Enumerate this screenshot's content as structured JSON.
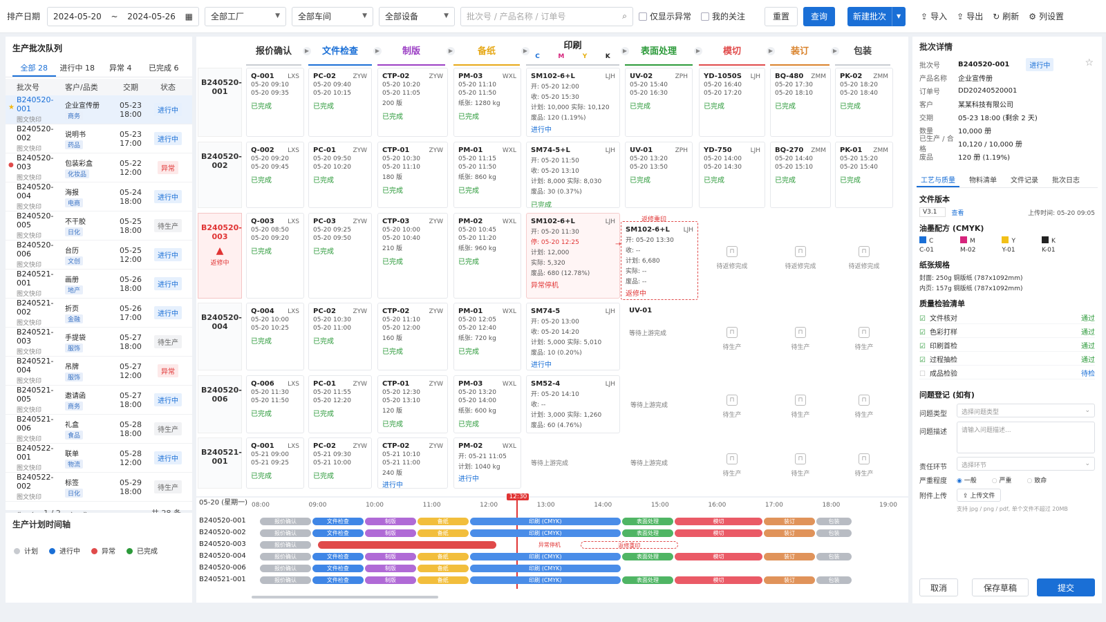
{
  "toolbar": {
    "date_label": "排产日期",
    "date_from": "2024-05-20",
    "date_sep": "~",
    "date_to": "2024-05-26",
    "factory": "全部工厂",
    "workshop": "全部车间",
    "device": "全部设备",
    "search_placeholder": "批次号 / 产品名称 / 订单号",
    "only_abnormal": "仅显示异常",
    "my_follow": "我的关注",
    "reset": "重置",
    "query": "查询",
    "new_batch": "新建批次",
    "import": "导入",
    "export": "导出",
    "refresh": "刷新",
    "column_settings": "列设置"
  },
  "queue": {
    "title": "生产批次队列",
    "tabs": [
      "全部 28",
      "进行中 18",
      "异常 4",
      "已完成 6"
    ],
    "headers": [
      "批次号",
      "客户/品类",
      "交期",
      "状态"
    ],
    "rows": [
      {
        "id": "B240520-001",
        "sub": "图文快印",
        "cat": "企业宣传册",
        "tag": "商务",
        "due": "05-23 18:00",
        "status": "进行中"
      },
      {
        "id": "B240520-002",
        "sub": "图文快印",
        "cat": "说明书",
        "tag": "药品",
        "due": "05-23 17:00",
        "status": "进行中"
      },
      {
        "id": "B240520-003",
        "sub": "图文快印",
        "cat": "包装彩盒",
        "tag": "化妆品",
        "due": "05-22 12:00",
        "status": "异常"
      },
      {
        "id": "B240520-004",
        "sub": "图文快印",
        "cat": "海报",
        "tag": "电商",
        "due": "05-24 18:00",
        "status": "进行中"
      },
      {
        "id": "B240520-005",
        "sub": "图文快印",
        "cat": "不干胶",
        "tag": "日化",
        "due": "05-25 18:00",
        "status": "待生产"
      },
      {
        "id": "B240520-006",
        "sub": "图文快印",
        "cat": "台历",
        "tag": "文创",
        "due": "05-25 12:00",
        "status": "进行中"
      },
      {
        "id": "B240521-001",
        "sub": "图文快印",
        "cat": "画册",
        "tag": "地产",
        "due": "05-26 18:00",
        "status": "进行中"
      },
      {
        "id": "B240521-002",
        "sub": "图文快印",
        "cat": "折页",
        "tag": "金融",
        "due": "05-26 17:00",
        "status": "进行中"
      },
      {
        "id": "B240521-003",
        "sub": "图文快印",
        "cat": "手提袋",
        "tag": "服饰",
        "due": "05-27 18:00",
        "status": "待生产"
      },
      {
        "id": "B240521-004",
        "sub": "图文快印",
        "cat": "吊牌",
        "tag": "服饰",
        "due": "05-27 12:00",
        "status": "异常"
      },
      {
        "id": "B240521-005",
        "sub": "图文快印",
        "cat": "邀请函",
        "tag": "商务",
        "due": "05-27 18:00",
        "status": "进行中"
      },
      {
        "id": "B240521-006",
        "sub": "图文快印",
        "cat": "礼盒",
        "tag": "食品",
        "due": "05-28 18:00",
        "status": "待生产"
      },
      {
        "id": "B240522-001",
        "sub": "图文快印",
        "cat": "联单",
        "tag": "物流",
        "due": "05-28 12:00",
        "status": "进行中"
      },
      {
        "id": "B240522-002",
        "sub": "图文快印",
        "cat": "标签",
        "tag": "日化",
        "due": "05-29 18:00",
        "status": "待生产"
      }
    ],
    "page": "1 / 2",
    "total": "共 28 条"
  },
  "legend": {
    "title": "生产计划时间轴",
    "items": [
      {
        "label": "计划",
        "color": "#c8cbd0"
      },
      {
        "label": "进行中",
        "color": "#1a6fd6"
      },
      {
        "label": "异常",
        "color": "#e04a4a"
      },
      {
        "label": "已完成",
        "color": "#2c9a3a"
      }
    ]
  },
  "stages": [
    {
      "name": "报价确认",
      "color": "#333"
    },
    {
      "name": "文件检查",
      "color": "#1a6fd6"
    },
    {
      "name": "制版",
      "color": "#9b3fc4"
    },
    {
      "name": "备纸",
      "color": "#e6a817"
    },
    {
      "name": "印刷",
      "color": "#222"
    },
    {
      "name": "表面处理",
      "color": "#2c9a3a"
    },
    {
      "name": "模切",
      "color": "#e04a4a"
    },
    {
      "name": "装订",
      "color": "#d9822b"
    },
    {
      "name": "包装",
      "color": "#444"
    }
  ],
  "cmyk": [
    "C",
    "M",
    "Y",
    "K"
  ],
  "grid": [
    {
      "batch": "B240520-001",
      "cards": [
        {
          "id": "Q-001",
          "op": "LXS",
          "l": [
            "05-20 09:10",
            "05-20 09:35"
          ],
          "s": "已完成"
        },
        {
          "id": "PC-02",
          "op": "ZYW",
          "l": [
            "05-20 09:40",
            "05-20 10:15"
          ],
          "s": "已完成"
        },
        {
          "id": "CTP-02",
          "op": "ZYW",
          "l": [
            "05-20 10:20",
            "05-20 11:05",
            "200 版"
          ],
          "s": "已完成"
        },
        {
          "id": "PM-03",
          "op": "WXL",
          "l": [
            "05-20 11:10",
            "05-20 11:50",
            "纸张: 1280 kg"
          ],
          "s": "已完成"
        },
        {
          "id": "SM102-6+L",
          "op": "LJH",
          "l": [
            "开: 05-20 12:00",
            "收: 05-20 15:30",
            "计划: 10,000    实际: 10,120",
            "废品: 120 (1.19%)"
          ],
          "s": "进行中"
        },
        {
          "id": "UV-02",
          "op": "ZPH",
          "l": [
            "05-20 15:40",
            "05-20 16:30"
          ],
          "s": "已完成"
        },
        {
          "id": "YD-1050S",
          "op": "LJH",
          "l": [
            "05-20 16:40",
            "05-20 17:20"
          ],
          "s": "已完成"
        },
        {
          "id": "BQ-480",
          "op": "ZMM",
          "l": [
            "05-20 17:30",
            "05-20 18:10"
          ],
          "s": "已完成"
        },
        {
          "id": "PK-02",
          "op": "ZMM",
          "l": [
            "05-20 18:20",
            "05-20 18:40"
          ],
          "s": "已完成"
        }
      ]
    },
    {
      "batch": "B240520-002",
      "cards": [
        {
          "id": "Q-002",
          "op": "LXS",
          "l": [
            "05-20 09:20",
            "05-20 09:45"
          ],
          "s": "已完成"
        },
        {
          "id": "PC-01",
          "op": "ZYW",
          "l": [
            "05-20 09:50",
            "05-20 10:20"
          ],
          "s": "已完成"
        },
        {
          "id": "CTP-01",
          "op": "ZYW",
          "l": [
            "05-20 10:30",
            "05-20 11:10",
            "180 版"
          ],
          "s": "已完成"
        },
        {
          "id": "PM-01",
          "op": "WXL",
          "l": [
            "05-20 11:15",
            "05-20 11:50",
            "纸张: 860 kg"
          ],
          "s": "已完成"
        },
        {
          "id": "SM74-5+L",
          "op": "LJH",
          "l": [
            "开: 05-20 11:50",
            "收: 05-20 13:10",
            "计划: 8,000    实际: 8,030",
            "废品: 30 (0.37%)"
          ],
          "s": "已完成"
        },
        {
          "id": "UV-01",
          "op": "ZPH",
          "l": [
            "05-20 13:20",
            "05-20 13:50"
          ],
          "s": "已完成"
        },
        {
          "id": "YD-750",
          "op": "LJH",
          "l": [
            "05-20 14:00",
            "05-20 14:30"
          ],
          "s": "已完成"
        },
        {
          "id": "BQ-270",
          "op": "ZMM",
          "l": [
            "05-20 14:40",
            "05-20 15:10"
          ],
          "s": "已完成"
        },
        {
          "id": "PK-01",
          "op": "ZMM",
          "l": [
            "05-20 15:20",
            "05-20 15:40"
          ],
          "s": "已完成"
        }
      ]
    },
    {
      "batch": "B240520-003",
      "alert": "返修中",
      "cards": [
        {
          "id": "Q-003",
          "op": "LXS",
          "l": [
            "05-20 08:50",
            "05-20 09:20"
          ],
          "s": "已完成"
        },
        {
          "id": "PC-03",
          "op": "ZYW",
          "l": [
            "05-20 09:25",
            "05-20 09:50"
          ],
          "s": "已完成"
        },
        {
          "id": "CTP-03",
          "op": "ZYW",
          "l": [
            "05-20 10:00",
            "05-20 10:40",
            "210 版"
          ],
          "s": "已完成"
        },
        {
          "id": "PM-02",
          "op": "WXL",
          "l": [
            "05-20 10:45",
            "05-20 11:20",
            "纸张: 960 kg"
          ],
          "s": "已完成"
        },
        {
          "id": "SM102-6+L",
          "op": "LJH",
          "l": [
            "开: 05-20 11:30",
            "停: 05-20 12:25",
            "计划: 12,000",
            "实际: 5,320",
            "废品: 680 (12.78%)"
          ],
          "s": "异常停机"
        },
        {
          "id": "SM102-6+L",
          "op": "LJH",
          "l": [
            "开: 05-20 13:30",
            "收: --",
            "计划: 6,680",
            "实际: --",
            "废品: --"
          ],
          "s": "返修中",
          "rework": "返修重印"
        }
      ],
      "waits": [
        "待返修完成",
        "待返修完成",
        "待返修完成"
      ]
    },
    {
      "batch": "B240520-004",
      "cards": [
        {
          "id": "Q-004",
          "op": "LXS",
          "l": [
            "05-20 10:00",
            "05-20 10:25"
          ],
          "s": "已完成"
        },
        {
          "id": "PC-02",
          "op": "ZYW",
          "l": [
            "05-20 10:30",
            "05-20 11:00"
          ],
          "s": "已完成"
        },
        {
          "id": "CTP-02",
          "op": "ZYW",
          "l": [
            "05-20 11:10",
            "05-20 12:00",
            "160 版"
          ],
          "s": "已完成"
        },
        {
          "id": "PM-01",
          "op": "WXL",
          "l": [
            "05-20 12:05",
            "05-20 12:40",
            "纸张: 720 kg"
          ],
          "s": "已完成"
        },
        {
          "id": "SM74-5",
          "op": "LJH",
          "l": [
            "开: 05-20 13:00",
            "收: 05-20 14:20",
            "计划: 5,000    实际: 5,010",
            "废品: 10 (0.20%)"
          ],
          "s": "进行中"
        },
        {
          "id": "UV-01",
          "op": "",
          "l": [
            "",
            "等待上游完成"
          ],
          "s": ""
        }
      ],
      "waits": [
        "待生产",
        "待生产",
        "待生产"
      ]
    },
    {
      "batch": "B240520-006",
      "cards": [
        {
          "id": "Q-006",
          "op": "LXS",
          "l": [
            "05-20 11:30",
            "05-20 11:50"
          ],
          "s": "已完成"
        },
        {
          "id": "PC-01",
          "op": "ZYW",
          "l": [
            "05-20 11:55",
            "05-20 12:20"
          ],
          "s": "已完成"
        },
        {
          "id": "CTP-01",
          "op": "ZYW",
          "l": [
            "05-20 12:30",
            "05-20 13:10",
            "120 版"
          ],
          "s": "已完成"
        },
        {
          "id": "PM-03",
          "op": "WXL",
          "l": [
            "05-20 13:20",
            "05-20 14:00",
            "纸张: 600 kg"
          ],
          "s": "已完成"
        },
        {
          "id": "SM52-4",
          "op": "LJH",
          "l": [
            "开: 05-20 14:10",
            "收: --",
            "计划: 3,000    实际: 1,260",
            "废品: 60 (4.76%)"
          ],
          "s": "进行中"
        }
      ],
      "waitup": "等待上游完成",
      "waits": [
        "待生产",
        "待生产",
        "待生产"
      ]
    },
    {
      "batch": "B240521-001",
      "cards": [
        {
          "id": "Q-001",
          "op": "LXS",
          "l": [
            "05-21 09:00",
            "05-21 09:25"
          ],
          "s": "已完成"
        },
        {
          "id": "PC-02",
          "op": "ZYW",
          "l": [
            "05-21 09:30",
            "05-21 10:00"
          ],
          "s": "已完成"
        },
        {
          "id": "CTP-02",
          "op": "ZYW",
          "l": [
            "05-21 10:10",
            "05-21 11:00",
            "240 版"
          ],
          "s": "进行中"
        },
        {
          "id": "PM-02",
          "op": "WXL",
          "l": [
            "开: 05-21 11:05",
            "计划: 1040 kg"
          ],
          "s": "进行中"
        }
      ],
      "waitup2": [
        "等待上游完成",
        "等待上游完成"
      ],
      "waits": [
        "待生产",
        "待生产",
        "待生产"
      ]
    }
  ],
  "timeline": {
    "date": "05-20 (星期一)",
    "now": "12:30",
    "ticks": [
      "08:00",
      "09:00",
      "10:00",
      "11:00",
      "12:00",
      "13:00",
      "14:00",
      "15:00",
      "16:00",
      "17:00",
      "18:00",
      "19:00"
    ],
    "rows": [
      "B240520-001",
      "B240520-002",
      "B240520-003",
      "B240520-004",
      "B240520-006",
      "B240521-001"
    ],
    "seg_labels": [
      "报价确认",
      "文件检查",
      "制版",
      "备纸",
      "印刷 (CMYK)",
      "表面处理",
      "模切",
      "装订",
      "包装"
    ],
    "abnormal": "异常停机",
    "rework": "返修重印"
  },
  "detail": {
    "title": "批次详情",
    "kv": [
      {
        "k": "批次号",
        "v": "B240520-001",
        "badge": "进行中"
      },
      {
        "k": "产品名称",
        "v": "企业宣传册"
      },
      {
        "k": "订单号",
        "v": "DD20240520001"
      },
      {
        "k": "客户",
        "v": "某某科技有限公司"
      },
      {
        "k": "交期",
        "v": "05-23 18:00 (剩余 2 天)"
      },
      {
        "k": "数量",
        "v": "10,000 册"
      },
      {
        "k": "已生产 / 合格",
        "v": "10,120 / 10,000 册"
      },
      {
        "k": "废品",
        "v": "120 册 (1.19%)"
      }
    ],
    "tabs": [
      "工艺与质量",
      "物料清单",
      "文件记录",
      "批次日志"
    ],
    "file_version": {
      "title": "文件版本",
      "version": "V3.1",
      "view": "查看",
      "upload_time": "上传时间: 05-20 09:05"
    },
    "ink": {
      "title": "油墨配方 (CMYK)",
      "items": [
        {
          "name": "C",
          "code": "C-01",
          "color": "#1a6fd6"
        },
        {
          "name": "M",
          "code": "M-02",
          "color": "#d6247c"
        },
        {
          "name": "Y",
          "code": "Y-01",
          "color": "#f2c018"
        },
        {
          "name": "K",
          "code": "K-01",
          "color": "#222222"
        }
      ]
    },
    "paper": {
      "title": "纸张规格",
      "cover": "封面:  250g 铜版纸 (787x1092mm)",
      "inner": "内页:  157g 铜版纸 (787x1092mm)"
    },
    "qc": {
      "title": "质量检验清单",
      "items": [
        {
          "name": "文件核对",
          "res": "通过"
        },
        {
          "name": "色彩打样",
          "res": "通过"
        },
        {
          "name": "印刷首检",
          "res": "通过"
        },
        {
          "name": "过程抽检",
          "res": "通过"
        },
        {
          "name": "成品检验",
          "res": "待检"
        }
      ]
    },
    "issue": {
      "title": "问题登记 (如有)",
      "type_label": "问题类型",
      "type_ph": "选择问题类型",
      "desc_label": "问题描述",
      "desc_ph": "请输入问题描述...",
      "resp_label": "责任环节",
      "resp_ph": "选择环节",
      "sev_label": "严重程度",
      "sev": [
        "一般",
        "严重",
        "致命"
      ],
      "att_label": "附件上传",
      "upload": "上传文件",
      "hint": "支持 jpg / png / pdf, 单个文件不超过 20MB"
    },
    "actions": {
      "cancel": "取消",
      "draft": "保存草稿",
      "submit": "提交"
    }
  }
}
